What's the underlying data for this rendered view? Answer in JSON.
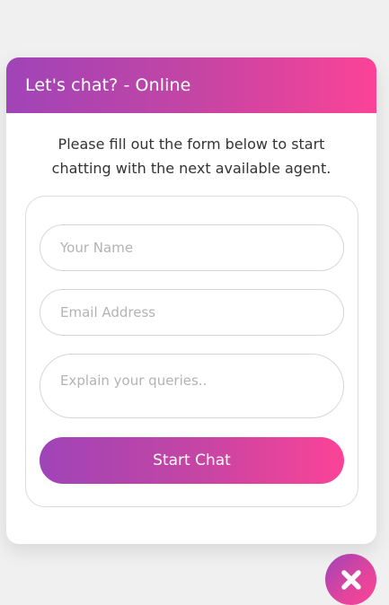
{
  "header": {
    "title": "Let's chat? - Online"
  },
  "intro": {
    "text": "Please fill out the form below to start chatting with the next available agent."
  },
  "form": {
    "name_placeholder": "Your Name",
    "email_placeholder": "Email Address",
    "query_placeholder": "Explain your queries..",
    "submit_label": "Start Chat"
  },
  "close_button": {
    "icon": "close-icon"
  },
  "colors": {
    "gradient_start": "#a044b8",
    "gradient_end": "#fb4397",
    "background": "#f0f0f1"
  }
}
